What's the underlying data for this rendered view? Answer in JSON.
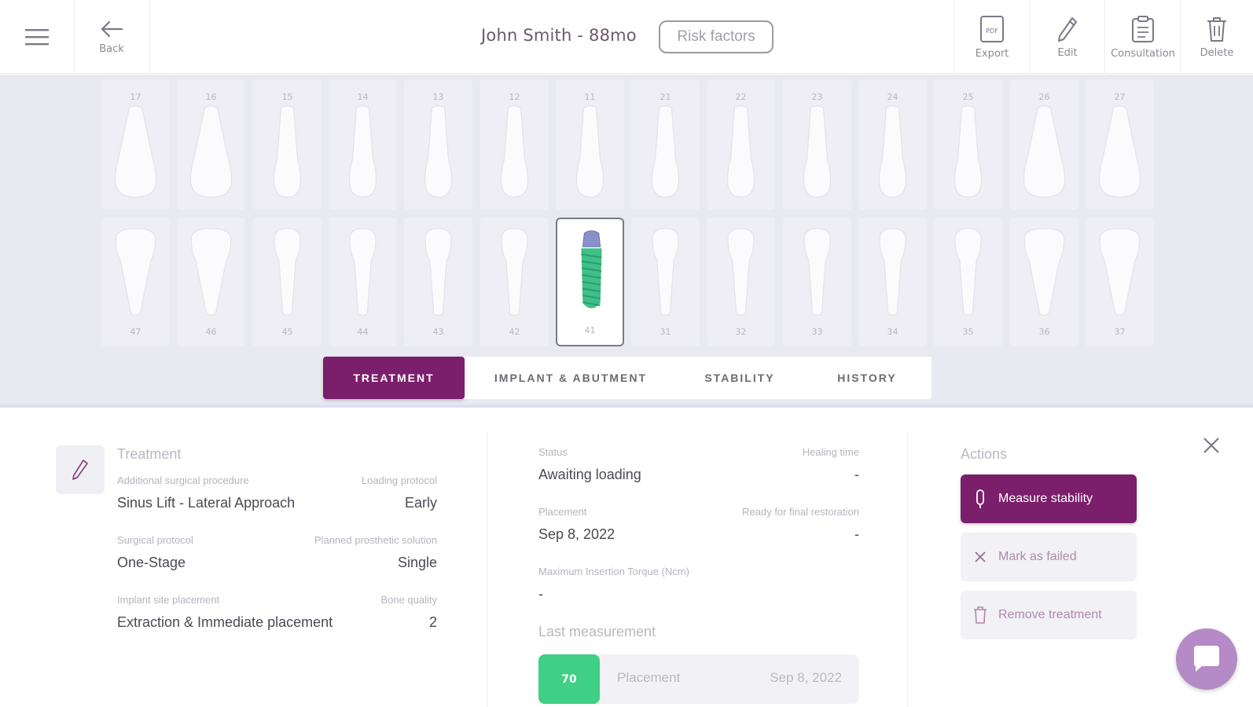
{
  "header": {
    "back_label": "Back",
    "patient_title": "John Smith - 88mo",
    "risk_factors_label": "Risk factors",
    "toolbar": {
      "export_label": "Export",
      "export_icon_text": "PDF",
      "edit_label": "Edit",
      "consultation_label": "Consultation",
      "delete_label": "Delete"
    },
    "icons": [
      "menu-icon",
      "arrow-left-icon",
      "pdf-icon",
      "pencil-icon",
      "clipboard-icon",
      "trash-icon"
    ]
  },
  "chart": {
    "upper_teeth": [
      "17",
      "16",
      "15",
      "14",
      "13",
      "12",
      "11",
      "21",
      "22",
      "23",
      "24",
      "25",
      "26",
      "27"
    ],
    "lower_teeth": [
      "47",
      "46",
      "45",
      "44",
      "43",
      "42",
      "41",
      "31",
      "32",
      "33",
      "34",
      "35",
      "36",
      "37"
    ],
    "selected_tooth": "41",
    "implant_color": "#3ec088"
  },
  "tabs": [
    {
      "label": "TREATMENT",
      "active": true
    },
    {
      "label": "IMPLANT & ABUTMENT",
      "active": false
    },
    {
      "label": "STABILITY",
      "active": false
    },
    {
      "label": "HISTORY",
      "active": false
    }
  ],
  "treatment": {
    "title": "Treatment",
    "additional_surgical_procedure_label": "Additional surgical procedure",
    "additional_surgical_procedure": "Sinus Lift - Lateral Approach",
    "loading_protocol_label": "Loading protocol",
    "loading_protocol": "Early",
    "surgical_protocol_label": "Surgical protocol",
    "surgical_protocol": "One-Stage",
    "planned_prosthetic_solution_label": "Planned prosthetic solution",
    "planned_prosthetic_solution": "Single",
    "implant_site_placement_label": "Implant site placement",
    "implant_site_placement": "Extraction & Immediate placement",
    "bone_quality_label": "Bone quality",
    "bone_quality": "2"
  },
  "status": {
    "status_label": "Status",
    "status": "Awaiting loading",
    "healing_time_label": "Healing time",
    "healing_time": "-",
    "placement_label": "Placement",
    "placement": "Sep 8, 2022",
    "ready_label": "Ready for final restoration",
    "ready": "-",
    "torque_label": "Maximum Insertion Torque (Ncm)",
    "torque": "-",
    "last_measurement_title": "Last measurement",
    "last_measurement": {
      "value": "70",
      "type": "Placement",
      "date": "Sep 8, 2022",
      "color": "#3fcf86"
    }
  },
  "actions": {
    "title": "Actions",
    "measure_stability": "Measure stability",
    "mark_as_failed": "Mark as failed",
    "remove_treatment": "Remove treatment"
  },
  "colors": {
    "brand": "#7b1f6c",
    "chart_bg": "#e9e9f1",
    "chat": "#b48bc6"
  }
}
